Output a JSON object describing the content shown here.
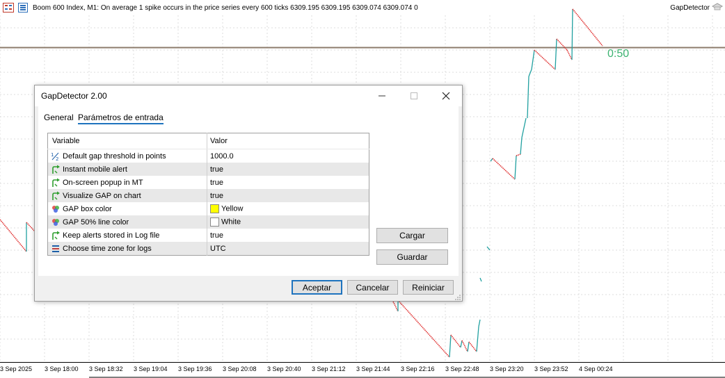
{
  "chart": {
    "header_text": "Boom 600 Index, M1:  On average 1 spike occurs in the price series every 600 ticks  6309.195 6309.195 6309.074 6309.074  0",
    "indicator_label": "GapDetector",
    "timer": "0:50",
    "time_labels": [
      "3 Sep 2025",
      "3 Sep 18:00",
      "3 Sep 18:32",
      "3 Sep 19:04",
      "3 Sep 19:36",
      "3 Sep 20:08",
      "3 Sep 20:40",
      "3 Sep 21:12",
      "3 Sep 21:44",
      "3 Sep 22:16",
      "3 Sep 22:48",
      "3 Sep 23:20",
      "3 Sep 23:52",
      "4 Sep 00:24"
    ],
    "colors": {
      "bear": "#e03030",
      "bull": "#20a0a0",
      "price_line": "#8c7b6b",
      "timer": "#3cb371"
    }
  },
  "dialog": {
    "title": "GapDetector 2.00",
    "tabs": [
      {
        "label": "General"
      },
      {
        "label": "Parámetros de entrada",
        "active": true
      }
    ],
    "table": {
      "headers": {
        "variable": "Variable",
        "value": "Valor"
      },
      "rows": [
        {
          "icon": "half-fraction-icon",
          "variable": "Default gap threshold in points",
          "value": "1000.0"
        },
        {
          "icon": "green-arrow-icon",
          "variable": "Instant mobile alert",
          "value": "true"
        },
        {
          "icon": "green-arrow-icon",
          "variable": "On-screen popup in MT",
          "value": "true"
        },
        {
          "icon": "green-arrow-icon",
          "variable": "Visualize GAP on chart",
          "value": "true"
        },
        {
          "icon": "color-palette-icon",
          "variable": "GAP box color",
          "value": "Yellow",
          "swatch": "#ffff00"
        },
        {
          "icon": "color-palette-icon",
          "variable": "GAP 50% line color",
          "value": "White",
          "swatch": "#ffffff"
        },
        {
          "icon": "green-arrow-icon",
          "variable": "Keep alerts stored in Log file",
          "value": "true"
        },
        {
          "icon": "enum-list-icon",
          "variable": "Choose time zone for logs",
          "value": "UTC"
        }
      ]
    },
    "buttons": {
      "load": "Cargar",
      "save": "Guardar",
      "ok": "Aceptar",
      "cancel": "Cancelar",
      "reset": "Reiniciar"
    }
  }
}
